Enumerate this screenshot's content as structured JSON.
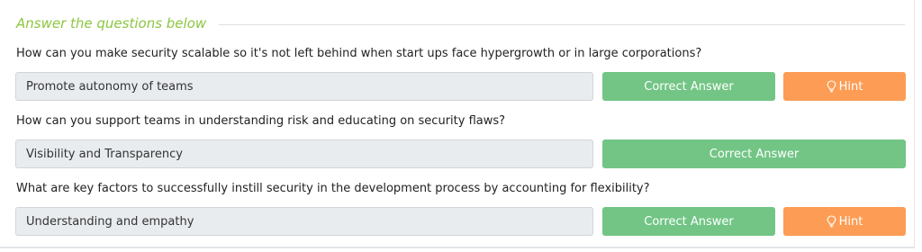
{
  "section": {
    "title": "Answer the questions below"
  },
  "questions": [
    {
      "text": "How can you make security scalable so it's not left behind when start ups face hypergrowth or in large corporations?",
      "answer": "Promote autonomy of teams",
      "correct_label": "Correct Answer",
      "hint_label": "Hint",
      "has_hint": true
    },
    {
      "text": "How can you support teams in understanding risk and educating on security flaws?",
      "answer": "Visibility and Transparency",
      "correct_label": "Correct Answer",
      "has_hint": false
    },
    {
      "text": "What are key factors to successfully instill security in the development process by accounting for flexibility?",
      "answer": "Understanding and empathy",
      "correct_label": "Correct Answer",
      "hint_label": "Hint",
      "has_hint": true
    }
  ],
  "colors": {
    "section_title": "#8cc63f",
    "correct_button": "#72c585",
    "hint_button": "#fd9d55",
    "answer_field_bg": "#e9ecef"
  },
  "icons": {
    "hint": "lightbulb-icon"
  }
}
